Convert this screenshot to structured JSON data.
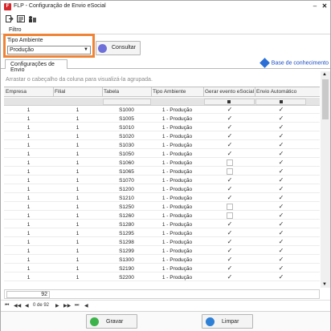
{
  "window": {
    "title": "FLP - Configuração de Envio eSocial",
    "app_icon_letter": "F"
  },
  "menu": {
    "filtro": "Filtro"
  },
  "filter": {
    "label": "Tipo Ambiente",
    "value": "Produção"
  },
  "buttons": {
    "consultar": "Consultar",
    "gravar": "Gravar",
    "limpar": "Limpar"
  },
  "tabs": {
    "config": "Configurações de Envio"
  },
  "base_link": "Base de conhecimento",
  "group_hint": "Arrastar o cabeçalho da coluna para visualizá-la agrupada.",
  "columns": [
    "Empresa",
    "Filial",
    "Tabela",
    "Tipo Ambiente",
    "Gerar evento eSocial",
    "Envio Automático"
  ],
  "rows": [
    {
      "empresa": "1",
      "filial": "1",
      "tabela": "S1000",
      "tipo": "1 - Produção",
      "gerar": true,
      "envio": true
    },
    {
      "empresa": "1",
      "filial": "1",
      "tabela": "S1005",
      "tipo": "1 - Produção",
      "gerar": true,
      "envio": true
    },
    {
      "empresa": "1",
      "filial": "1",
      "tabela": "S1010",
      "tipo": "1 - Produção",
      "gerar": true,
      "envio": true
    },
    {
      "empresa": "1",
      "filial": "1",
      "tabela": "S1020",
      "tipo": "1 - Produção",
      "gerar": true,
      "envio": true
    },
    {
      "empresa": "1",
      "filial": "1",
      "tabela": "S1030",
      "tipo": "1 - Produção",
      "gerar": true,
      "envio": true
    },
    {
      "empresa": "1",
      "filial": "1",
      "tabela": "S1050",
      "tipo": "1 - Produção",
      "gerar": true,
      "envio": true
    },
    {
      "empresa": "1",
      "filial": "1",
      "tabela": "S1060",
      "tipo": "1 - Produção",
      "gerar": false,
      "envio": true
    },
    {
      "empresa": "1",
      "filial": "1",
      "tabela": "S1065",
      "tipo": "1 - Produção",
      "gerar": false,
      "envio": true
    },
    {
      "empresa": "1",
      "filial": "1",
      "tabela": "S1070",
      "tipo": "1 - Produção",
      "gerar": true,
      "envio": true
    },
    {
      "empresa": "1",
      "filial": "1",
      "tabela": "S1200",
      "tipo": "1 - Produção",
      "gerar": true,
      "envio": true
    },
    {
      "empresa": "1",
      "filial": "1",
      "tabela": "S1210",
      "tipo": "1 - Produção",
      "gerar": true,
      "envio": true
    },
    {
      "empresa": "1",
      "filial": "1",
      "tabela": "S1250",
      "tipo": "1 - Produção",
      "gerar": false,
      "envio": true
    },
    {
      "empresa": "1",
      "filial": "1",
      "tabela": "S1260",
      "tipo": "1 - Produção",
      "gerar": false,
      "envio": true
    },
    {
      "empresa": "1",
      "filial": "1",
      "tabela": "S1280",
      "tipo": "1 - Produção",
      "gerar": true,
      "envio": true
    },
    {
      "empresa": "1",
      "filial": "1",
      "tabela": "S1295",
      "tipo": "1 - Produção",
      "gerar": true,
      "envio": true
    },
    {
      "empresa": "1",
      "filial": "1",
      "tabela": "S1298",
      "tipo": "1 - Produção",
      "gerar": true,
      "envio": true
    },
    {
      "empresa": "1",
      "filial": "1",
      "tabela": "S1299",
      "tipo": "1 - Produção",
      "gerar": true,
      "envio": true
    },
    {
      "empresa": "1",
      "filial": "1",
      "tabela": "S1300",
      "tipo": "1 - Produção",
      "gerar": true,
      "envio": true
    },
    {
      "empresa": "1",
      "filial": "1",
      "tabela": "S2190",
      "tipo": "1 - Produção",
      "gerar": true,
      "envio": true
    },
    {
      "empresa": "1",
      "filial": "1",
      "tabela": "S2200",
      "tipo": "1 - Produção",
      "gerar": true,
      "envio": true
    }
  ],
  "total": "92",
  "navigator": {
    "page_info": "0 de 92"
  },
  "colors": {
    "accent_orange": "#f08436",
    "brand_red": "#d7262b",
    "link_blue": "#1e4fc0"
  }
}
